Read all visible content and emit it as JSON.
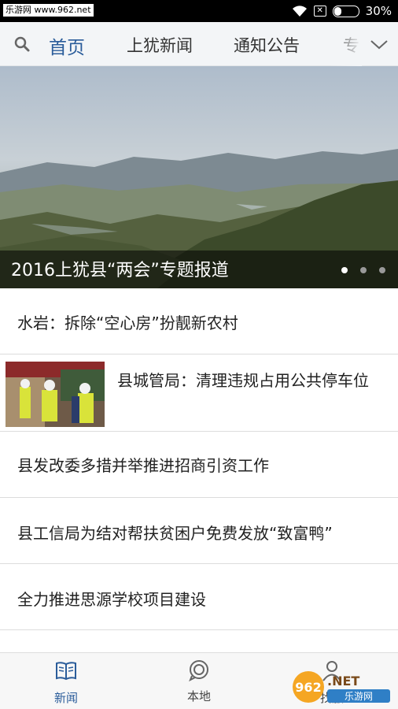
{
  "status_bar": {
    "watermark": "乐游网 www.962.net",
    "battery": "30%",
    "battery_level": 0.3
  },
  "nav": {
    "tabs": [
      {
        "label": "首页",
        "active": true
      },
      {
        "label": "上犹新闻",
        "active": false
      },
      {
        "label": "通知公告",
        "active": false
      },
      {
        "label": "专",
        "active": false
      }
    ]
  },
  "banner": {
    "caption": "2016上犹县“两会”专题报道",
    "slide_count": 3,
    "active_slide": 1
  },
  "news": [
    {
      "title": "水岩：拆除“空心房”扮靓新农村",
      "has_image": false
    },
    {
      "title": "县城管局：清理违规占用公共停车位",
      "has_image": true
    },
    {
      "title": "县发改委多措并举推进招商引资工作",
      "has_image": false
    },
    {
      "title": "县工信局为结对帮扶贫困户免费发放“致富鸭”",
      "has_image": false
    },
    {
      "title": "全力推进思源学校项目建设",
      "has_image": false
    }
  ],
  "tabbar": {
    "tabs": [
      {
        "label": "新闻",
        "icon": "book-icon",
        "active": true
      },
      {
        "label": "本地",
        "icon": "chat-bubble-icon",
        "active": false
      },
      {
        "label": "找服",
        "icon": "person-icon",
        "active": false
      }
    ],
    "watermark_logo": "962.NET 乐游网"
  },
  "colors": {
    "accent": "#2a5c9a",
    "nav_bg": "#f3f5f7",
    "status_bg": "#000000"
  }
}
